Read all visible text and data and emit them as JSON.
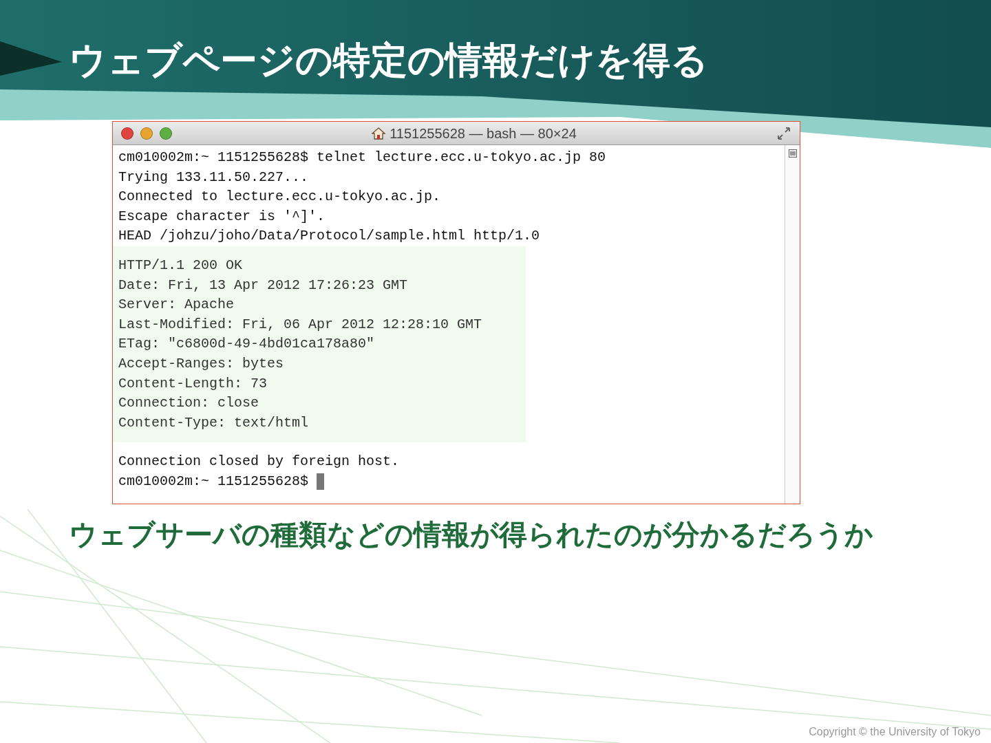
{
  "slide": {
    "title": "ウェブページの特定の情報だけを得る",
    "caption": "ウェブサーバの種類などの情報が得られたのが分かるだろうか",
    "footer": "Copyright © the University of Tokyo"
  },
  "terminal": {
    "title": "1151255628 — bash — 80×24",
    "blocks": [
      {
        "highlighted": false,
        "lines": [
          "cm010002m:~ 1151255628$ telnet lecture.ecc.u-tokyo.ac.jp 80",
          "Trying 133.11.50.227...",
          "Connected to lecture.ecc.u-tokyo.ac.jp.",
          "Escape character is '^]'.",
          "HEAD /johzu/joho/Data/Protocol/sample.html http/1.0"
        ]
      },
      {
        "highlighted": true,
        "lines": [
          "HTTP/1.1 200 OK",
          "Date: Fri, 13 Apr 2012 17:26:23 GMT",
          "Server: Apache",
          "Last-Modified: Fri, 06 Apr 2012 12:28:10 GMT",
          "ETag: \"c6800d-49-4bd01ca178a80\"",
          "Accept-Ranges: bytes",
          "Content-Length: 73",
          "Connection: close",
          "Content-Type: text/html"
        ]
      },
      {
        "highlighted": false,
        "lines": [
          "Connection closed by foreign host."
        ]
      }
    ],
    "prompt": "cm010002m:~ 1151255628$"
  }
}
